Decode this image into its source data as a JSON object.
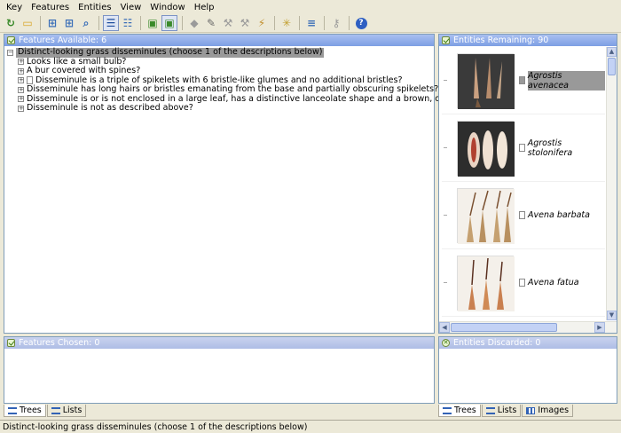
{
  "menu": [
    "Key",
    "Features",
    "Entities",
    "View",
    "Window",
    "Help"
  ],
  "toolbar": [
    {
      "name": "restart-icon",
      "glyph": "↻",
      "color": "#3a8a2a"
    },
    {
      "name": "open-folder-icon",
      "glyph": "▭",
      "color": "#d9a629"
    },
    {
      "name": "sep"
    },
    {
      "name": "features-best-icon",
      "glyph": "⊞",
      "color": "#3b6fb8"
    },
    {
      "name": "features-separate-icon",
      "glyph": "⊞",
      "color": "#3b6fb8"
    },
    {
      "name": "find-icon",
      "glyph": "⌕",
      "color": "#3b6fb8"
    },
    {
      "name": "sep"
    },
    {
      "name": "tree-view-icon",
      "glyph": "☰",
      "color": "#1d4d9e",
      "pressed": true
    },
    {
      "name": "list-view-icon",
      "glyph": "☷",
      "color": "#3b6fb8"
    },
    {
      "name": "sep"
    },
    {
      "name": "image-view-icon",
      "glyph": "▣",
      "color": "#3a8a2a"
    },
    {
      "name": "image-check-icon",
      "glyph": "▣",
      "color": "#3a8a2a",
      "pressed": true
    },
    {
      "name": "sep"
    },
    {
      "name": "tag-icon",
      "glyph": "◆",
      "color": "#9a9a9a"
    },
    {
      "name": "wand-icon",
      "glyph": "✎",
      "color": "#6a6a6a"
    },
    {
      "name": "hammer-icon",
      "glyph": "⚒",
      "color": "#9a9a9a"
    },
    {
      "name": "pick-icon",
      "glyph": "⚒",
      "color": "#9a9a9a"
    },
    {
      "name": "broom-icon",
      "glyph": "⚡",
      "color": "#c29030"
    },
    {
      "name": "sep"
    },
    {
      "name": "discard-icon",
      "glyph": "✳",
      "color": "#c2a030"
    },
    {
      "name": "sep"
    },
    {
      "name": "sort-icon",
      "glyph": "≡",
      "color": "#3b6fb8"
    },
    {
      "name": "sep"
    },
    {
      "name": "key-icon",
      "glyph": "⚷",
      "color": "#9a9a9a"
    },
    {
      "name": "sep"
    },
    {
      "name": "help-icon",
      "glyph": "?",
      "color": "#ffffff",
      "bg": "#2e5fc2"
    }
  ],
  "features_available": {
    "title": "Features Available: 6",
    "root": "Distinct-looking grass disseminules (choose 1 of the descriptions below)",
    "items": [
      {
        "label": "Looks like a small bulb?",
        "doc": false
      },
      {
        "label": "A bur covered with spines?",
        "doc": false
      },
      {
        "label": "Disseminule is a triple of spikelets with 6 bristle-like glumes and no additional bristles?",
        "doc": true
      },
      {
        "label": "Disseminule has long hairs or bristles emanating from the base and partially obscuring spikelets?",
        "doc": false
      },
      {
        "label": "Disseminule is or is not enclosed in a large leaf, has a distinctive lanceolate shape and a brown, oblong caryopsis?",
        "doc": false
      },
      {
        "label": "Disseminule is not as described above?",
        "doc": false
      }
    ]
  },
  "features_chosen": {
    "title": "Features Chosen: 0"
  },
  "entities_remaining": {
    "title": "Entities Remaining: 90",
    "items": [
      {
        "name": "Agrostis avenacea",
        "selected": true
      },
      {
        "name": "Agrostis stolonifera",
        "selected": false
      },
      {
        "name": "Avena barbata",
        "selected": false
      },
      {
        "name": "Avena fatua",
        "selected": false
      }
    ]
  },
  "entities_discarded": {
    "title": "Entities Discarded: 0"
  },
  "left_tabs": [
    "Trees",
    "Lists"
  ],
  "right_tabs": [
    "Trees",
    "Lists",
    "Images"
  ],
  "status": "Distinct-looking grass disseminules (choose 1 of the descriptions below)"
}
